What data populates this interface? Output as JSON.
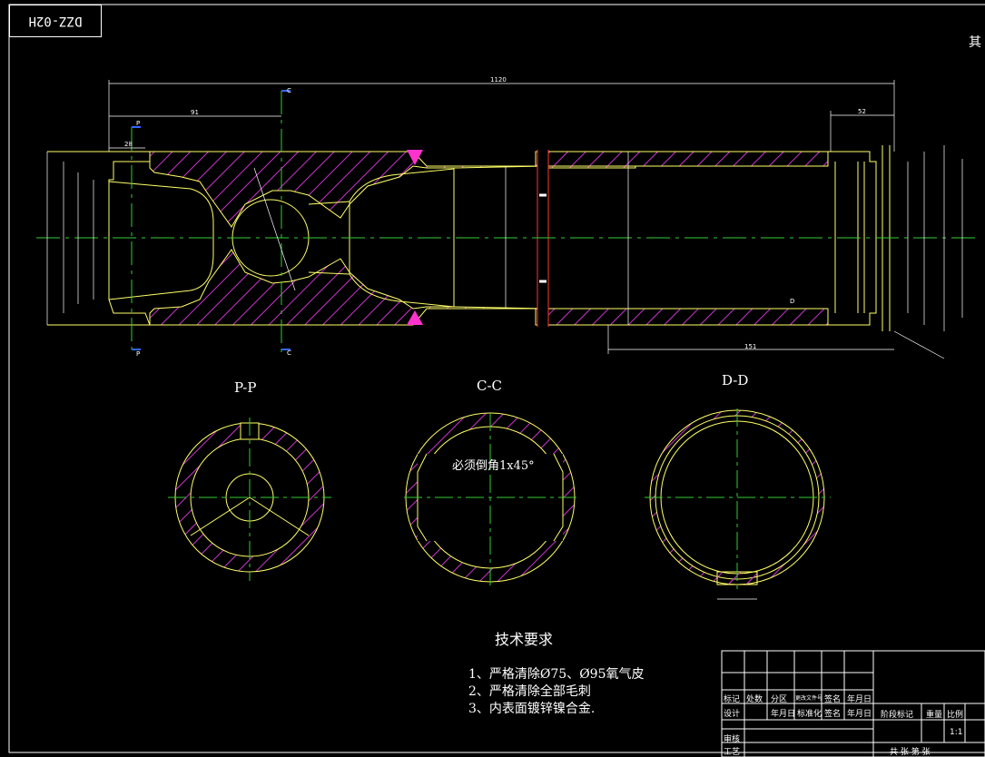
{
  "drawing": {
    "stamp": "DZZ-02H",
    "corner_text": "其",
    "overall_length": "1120",
    "dim_left_offset": "91",
    "dim_left_small": "28",
    "dim_right_top": "52",
    "dim_right_long": "151",
    "section_c_mark": "C",
    "section_p_mark": "P",
    "section_d_mark": "D"
  },
  "views": {
    "pp_label": "P-P",
    "cc_label": "C-C",
    "dd_label": "D-D",
    "cc_note": "必须倒角1x45°"
  },
  "requirements": {
    "title": "技术要求",
    "items": [
      "1、严格清除Ø75、Ø95氧气皮",
      "2、严格清除全部毛刺",
      "3、内表面镀锌镍合金."
    ]
  },
  "title_block": {
    "row1": [
      "标记",
      "处数",
      "分区",
      "更改文件号",
      "签名",
      "年月日"
    ],
    "row2": [
      "设计",
      "",
      "年月日",
      "标准化",
      "签名",
      "年月日"
    ],
    "row3": [
      "审核"
    ],
    "row4": [
      "工艺"
    ],
    "stage_label": "阶段标记",
    "weight_label": "重量",
    "scale_label": "比例",
    "scale_value": "1:1",
    "sheets_label": "共  张  第  张"
  },
  "colors": {
    "outline": "#ffff66",
    "hatch": "#cc33cc",
    "center": "#33cc33",
    "dimension": "#ffffff",
    "weld": "#ff33cc",
    "section_mark": "#3366ff"
  }
}
